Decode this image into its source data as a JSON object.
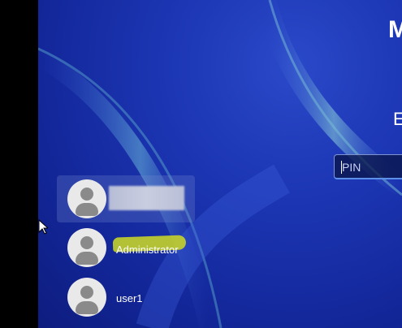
{
  "header": {
    "title_fragment": "M",
    "subtitle_fragment": "E"
  },
  "pin": {
    "placeholder": "PIN"
  },
  "users": [
    {
      "name": "",
      "selected": true,
      "blurred": true
    },
    {
      "name": "Administrator",
      "selected": false,
      "highlighted": true
    },
    {
      "name": "user1",
      "selected": false
    }
  ],
  "icons": {
    "avatar": "user-avatar-icon",
    "cursor": "mouse-pointer-icon"
  },
  "colors": {
    "wallpaper": "#1c36b4",
    "highlight": "#c4d22a",
    "pin_border": "#5b8fe8"
  }
}
